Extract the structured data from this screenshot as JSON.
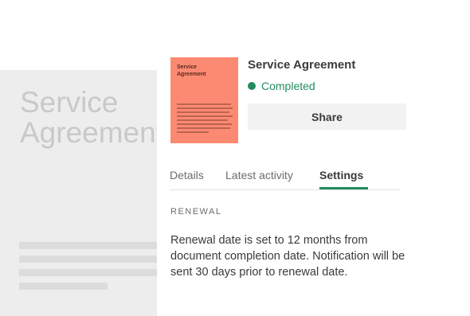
{
  "background_document": {
    "title": "Service\nAgreement"
  },
  "document": {
    "thumbnail_title": "Service\nAgreement",
    "title": "Service Agreement",
    "status": "Completed",
    "status_color": "#248b5e",
    "thumbnail_color": "#fc8a72"
  },
  "actions": {
    "share_label": "Share"
  },
  "tabs": [
    {
      "label": "Details",
      "active": false
    },
    {
      "label": "Latest activity",
      "active": false
    },
    {
      "label": "Settings",
      "active": true
    }
  ],
  "settings": {
    "section_label": "RENEWAL",
    "renewal_text": "Renewal date is set to 12 months from document completion date. Notification will be sent 30 days prior to renewal date."
  }
}
